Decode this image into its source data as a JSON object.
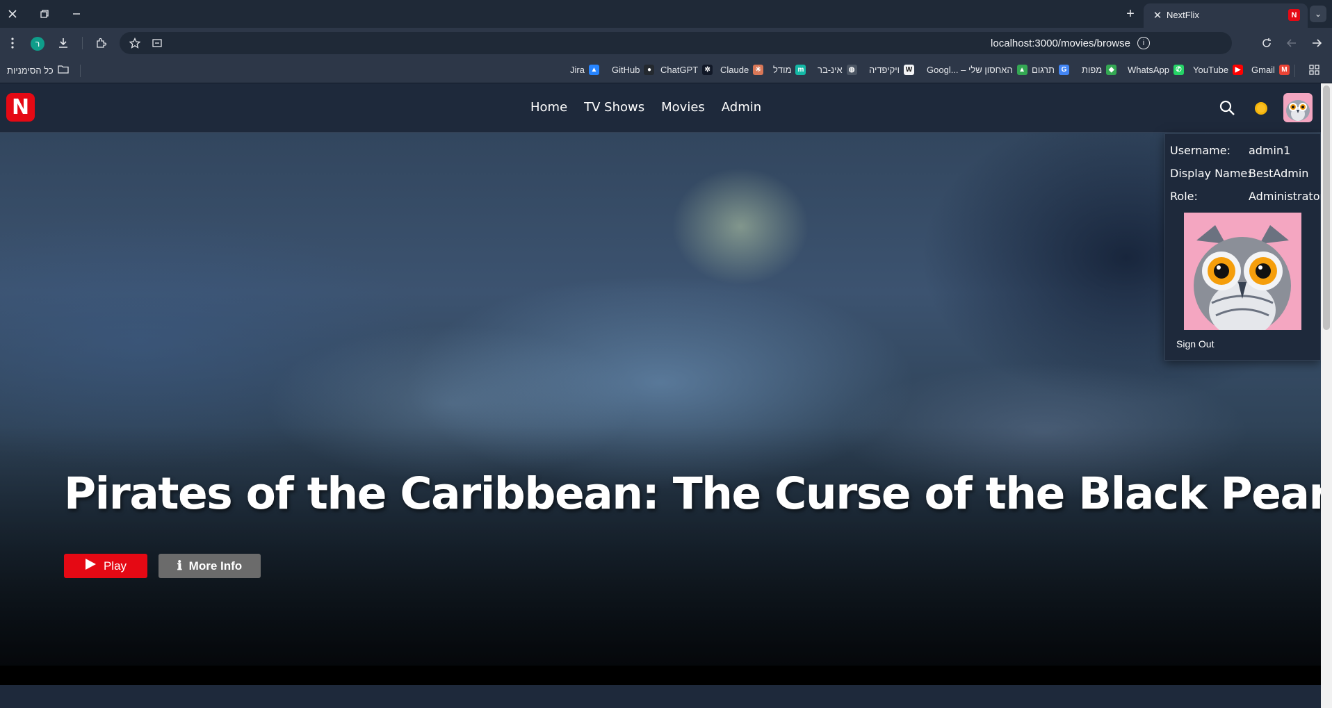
{
  "browser": {
    "tab_title": "NextFlix",
    "tab_favicon": "N",
    "url": "localhost:3000/movies/browse",
    "profile_initial": "ר",
    "all_bookmarks_label": "כל הסימניות",
    "bookmarks": [
      {
        "label": "Jira",
        "icon": "jira-icon",
        "color": "#2684ff",
        "glyph": "▲"
      },
      {
        "label": "GitHub",
        "icon": "github-icon",
        "color": "#24292f",
        "glyph": "●"
      },
      {
        "label": "ChatGPT",
        "icon": "chatgpt-icon",
        "color": "#111827",
        "glyph": "✲"
      },
      {
        "label": "Claude",
        "icon": "claude-icon",
        "color": "#d97757",
        "glyph": "✳"
      },
      {
        "label": "מודל",
        "icon": "moodle-icon",
        "color": "#14b8a6",
        "glyph": "m"
      },
      {
        "label": "אינ-בר",
        "icon": "globe-icon",
        "color": "#4b5563",
        "glyph": "◍"
      },
      {
        "label": "ויקיפדיה",
        "icon": "wikipedia-icon",
        "color": "#f3f4f6",
        "glyph": "W"
      },
      {
        "label": "Googl... – האחסון שלי",
        "icon": "google-drive-icon",
        "color": "#34a853",
        "glyph": "▲"
      },
      {
        "label": "תרגום",
        "icon": "google-translate-icon",
        "color": "#4285f4",
        "glyph": "G"
      },
      {
        "label": "מפות",
        "icon": "google-maps-icon",
        "color": "#34a853",
        "glyph": "◆"
      },
      {
        "label": "WhatsApp",
        "icon": "whatsapp-icon",
        "color": "#25d366",
        "glyph": "✆"
      },
      {
        "label": "YouTube",
        "icon": "youtube-icon",
        "color": "#ff0000",
        "glyph": "▶"
      },
      {
        "label": "Gmail",
        "icon": "gmail-icon",
        "color": "#ea4335",
        "glyph": "M"
      }
    ]
  },
  "app": {
    "logo_letter": "N",
    "nav": [
      "Home",
      "TV Shows",
      "Movies",
      "Admin"
    ],
    "brand_color": "#e50914"
  },
  "profile": {
    "username_label": "Username:",
    "username": "admin1",
    "display_name_label": "Display Name:",
    "display_name": "BestAdmin",
    "role_label": "Role:",
    "role": "Administrator",
    "sign_out": "Sign Out"
  },
  "hero": {
    "title": "Pirates of the Caribbean: The Curse of the Black Pearl",
    "play_label": "Play",
    "more_info_label": "More Info"
  }
}
